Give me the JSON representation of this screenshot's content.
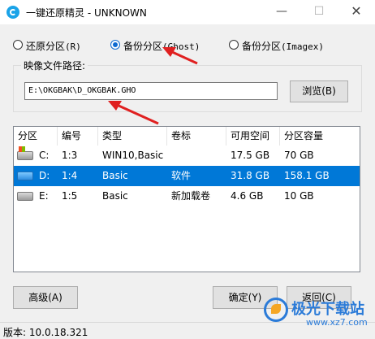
{
  "window": {
    "title": "一键还原精灵 - UNKNOWN",
    "minimize_glyph": "—",
    "maximize_glyph": "☐",
    "close_glyph": "✕"
  },
  "modes": [
    {
      "label_prefix": "还原分区",
      "label_suffix": "(R)",
      "selected": false
    },
    {
      "label_prefix": "备份分区",
      "label_suffix": "(Ghost)",
      "selected": true
    },
    {
      "label_prefix": "备份分区",
      "label_suffix": "(Imagex)",
      "selected": false
    }
  ],
  "image_path": {
    "group_label": "映像文件路径:",
    "value": "E:\\OKGBAK\\D_OKGBAK.GHO",
    "browse_label": "浏览(B)"
  },
  "table": {
    "columns": [
      "分区",
      "编号",
      "类型",
      "卷标",
      "可用空间",
      "分区容量"
    ],
    "rows": [
      {
        "drive": "C:",
        "number": "1:3",
        "type": "WIN10,Basic",
        "label": "",
        "free": "17.5 GB",
        "capacity": "70 GB",
        "selected": false,
        "icon": "windows-drive-icon"
      },
      {
        "drive": "D:",
        "number": "1:4",
        "type": "Basic",
        "label": "软件",
        "free": "31.8 GB",
        "capacity": "158.1 GB",
        "selected": true,
        "icon": "drive-icon"
      },
      {
        "drive": "E:",
        "number": "1:5",
        "type": "Basic",
        "label": "新加载卷",
        "free": "4.6 GB",
        "capacity": "10 GB",
        "selected": false,
        "icon": "drive-icon"
      }
    ]
  },
  "buttons": {
    "advanced": "高级(A)",
    "ok": "确定(Y)",
    "back": "返回(C)"
  },
  "status": {
    "version": "版本: 10.0.18.321"
  },
  "watermark": {
    "text": "极光下载站",
    "url": "www.xz7.com"
  },
  "colors": {
    "selection": "#0078d7",
    "annotation_arrow": "#e02020"
  }
}
